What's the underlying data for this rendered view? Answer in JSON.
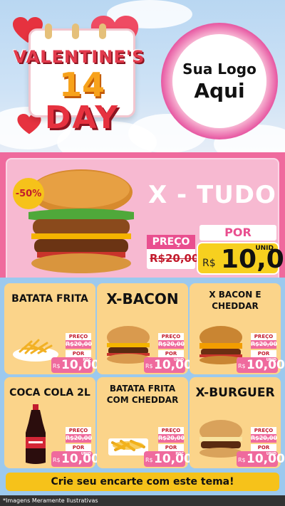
{
  "header": {
    "valentines": "VALENTINE'S",
    "fourteen": "14",
    "day": "DAY",
    "logo_line1": "Sua Logo",
    "logo_line2": "Aqui"
  },
  "featured": {
    "discount": "-50%",
    "title": "X - TUDO",
    "preco_label": "PREÇO",
    "old_price": "R$20,00",
    "por_label": "POR",
    "currency": "R$",
    "price": "10,00",
    "unid": "UNID"
  },
  "products": [
    {
      "title": "BATATA FRITA",
      "preco_label": "PREÇO",
      "old_price": "R$20,00",
      "por_label": "POR",
      "currency": "R$",
      "price": "10,00",
      "unit": "POÇ"
    },
    {
      "title": "X-BACON",
      "preco_label": "PREÇO",
      "old_price": "R$20,00",
      "por_label": "POR",
      "currency": "R$",
      "price": "10,00",
      "unit": "UNID"
    },
    {
      "title": "X BACON E CHEDDAR",
      "preco_label": "PREÇO",
      "old_price": "R$20,00",
      "por_label": "POR",
      "currency": "R$",
      "price": "10,00",
      "unit": "UNID"
    },
    {
      "title": "COCA COLA 2L",
      "preco_label": "PREÇO",
      "old_price": "R$20,00",
      "por_label": "POR",
      "currency": "R$",
      "price": "10,00",
      "unit": "UNID"
    },
    {
      "title": "BATATA FRITA COM CHEDDAR",
      "preco_label": "PREÇO",
      "old_price": "R$20,00",
      "por_label": "POR",
      "currency": "R$",
      "price": "10,00",
      "unit": "POÇ"
    },
    {
      "title": "X-BURGUER",
      "preco_label": "PREÇO",
      "old_price": "R$20,00",
      "por_label": "POR",
      "currency": "R$",
      "price": "10,00",
      "unit": "UNID"
    }
  ],
  "cta": "Crie seu encarte com este tema!",
  "disclaimer": "*Imagens Meramente Ilustrativas",
  "colors": {
    "pink": "#ef6a9d",
    "pink_light": "#f7b9d1",
    "yellow": "#f7d01f",
    "card": "#fbd48a",
    "sky": "#9cc9ee",
    "red": "#e23a4c"
  },
  "icons": [
    "heart-icon",
    "calendar-icon",
    "burger-image",
    "fries-image",
    "soda-bottle-image"
  ]
}
